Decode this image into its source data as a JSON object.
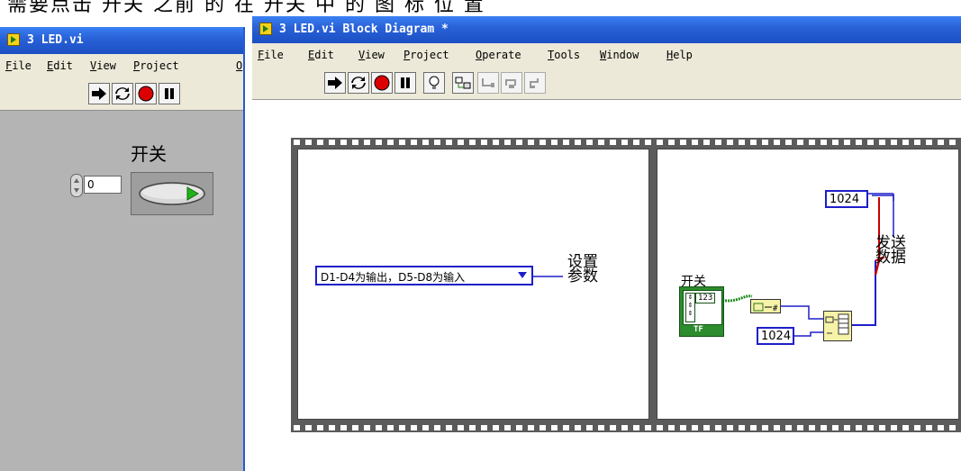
{
  "caption": "需要点击 开关 之前 的 在 开关 中 的 图 标 位 置",
  "front_panel": {
    "title": "3 LED.vi",
    "menu": [
      "File",
      "Edit",
      "View",
      "Project",
      "O"
    ],
    "control_label": "开关",
    "numeric_value": "0"
  },
  "block_diagram": {
    "title": "3 LED.vi Block Diagram *",
    "menu": [
      "File",
      "Edit",
      "View",
      "Project",
      "Operate",
      "Tools",
      "Window",
      "Help"
    ],
    "enum_value": "D1-D4为输出，D5-D8为输入",
    "node1_label_line1": "设置",
    "node1_label_line2": "参数",
    "terminal_label": "开关",
    "terminal_type": "123",
    "terminal_tf": "TF",
    "const_top": "1024",
    "const_bottom": "1024",
    "node2_label_line1": "发送",
    "node2_label_line2": "数据"
  },
  "colors": {
    "wire_blue": "#1e1ec8",
    "wire_green": "#1f8c1f",
    "wire_red": "#c80000",
    "title_blue": "#2a62d8"
  }
}
